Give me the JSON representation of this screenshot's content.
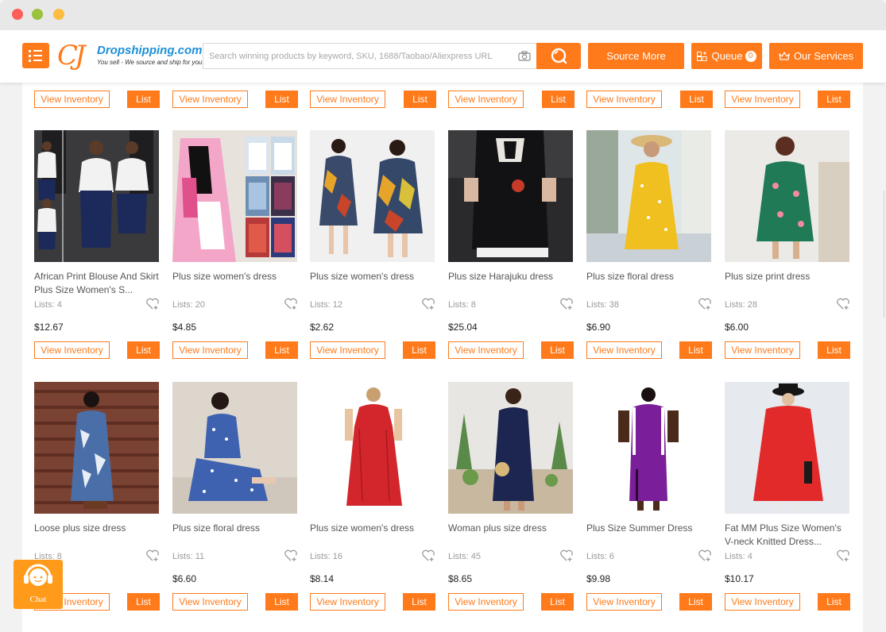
{
  "header": {
    "logo_mark": "CJ",
    "logo_name": "Dropshipping.com",
    "logo_tagline": "You sell - We source and ship for you!",
    "search_placeholder": "Search winning products by keyword, SKU, 1688/Taobao/Aliexpress URL",
    "source_more": "Source More",
    "queue_label": "Queue",
    "queue_count": "0",
    "services_label": "Our Services"
  },
  "actions": {
    "view_inventory": "View Inventory",
    "list": "List"
  },
  "chat": {
    "label": "Chat"
  },
  "colors": {
    "accent": "#ff7a1a",
    "chat": "#ff9a1a"
  },
  "rows": [
    {
      "products": [
        {
          "title": "African Print Blouse And Skirt Plus Size Women's S...",
          "lists": "Lists: 4",
          "price": "$12.67"
        },
        {
          "title": "Plus size women's dress",
          "lists": "Lists: 20",
          "price": "$4.85"
        },
        {
          "title": "Plus size women's dress",
          "lists": "Lists: 12",
          "price": "$2.62"
        },
        {
          "title": "Plus size Harajuku dress",
          "lists": "Lists: 8",
          "price": "$25.04"
        },
        {
          "title": "Plus size floral dress",
          "lists": "Lists: 38",
          "price": "$6.90"
        },
        {
          "title": "Plus size print dress",
          "lists": "Lists: 28",
          "price": "$6.00"
        }
      ]
    },
    {
      "products": [
        {
          "title": "Loose plus size dress",
          "lists": "Lists: 8",
          "price": ""
        },
        {
          "title": "Plus size floral dress",
          "lists": "Lists: 11",
          "price": "$6.60"
        },
        {
          "title": "Plus size women's dress",
          "lists": "Lists: 16",
          "price": "$8.14"
        },
        {
          "title": "Woman plus size dress",
          "lists": "Lists: 45",
          "price": "$8.65"
        },
        {
          "title": "Plus Size Summer Dress",
          "lists": "Lists: 6",
          "price": "$9.98"
        },
        {
          "title": "Fat MM Plus Size Women's V-neck Knitted Dress...",
          "lists": "Lists: 4",
          "price": "$10.17"
        }
      ]
    }
  ]
}
